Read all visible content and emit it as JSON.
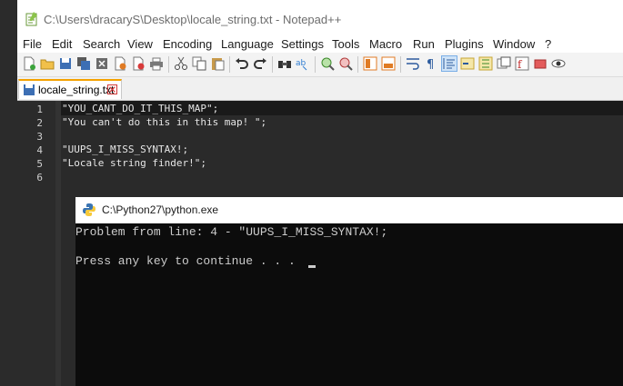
{
  "notepad": {
    "title": "C:\\Users\\dracaryS\\Desktop\\locale_string.txt - Notepad++",
    "menu": [
      "File",
      "Edit",
      "Search",
      "View",
      "Encoding",
      "Language",
      "Settings",
      "Tools",
      "Macro",
      "Run",
      "Plugins",
      "Window",
      "?"
    ],
    "tab_label": "locale_string.txt",
    "line_numbers": [
      "1",
      "2",
      "3",
      "4",
      "5",
      "6"
    ],
    "lines": [
      "\"YOU_CANT_DO_IT_THIS_MAP\";",
      "\"You can't do this in this map! \";",
      "",
      "\"UUPS_I_MISS_SYNTAX!;",
      "\"Locale string finder!\";",
      ""
    ],
    "toolbar_icons": [
      "new-file-icon",
      "open-file-icon",
      "save-icon",
      "save-all-icon",
      "close-icon",
      "close-all-icon",
      "print-icon",
      "cut-icon",
      "copy-icon",
      "paste-icon",
      "undo-icon",
      "redo-icon",
      "find-icon",
      "replace-icon",
      "zoom-in-icon",
      "zoom-out-icon",
      "sync-vertical-icon",
      "sync-horizontal-icon",
      "word-wrap-icon",
      "show-all-chars-icon",
      "indent-guide-icon",
      "doc-map-icon",
      "function-list-icon",
      "folder-workspace-icon",
      "record-macro-icon",
      "stop-macro-icon",
      "play-macro-icon"
    ]
  },
  "console": {
    "title": "C:\\Python27\\python.exe",
    "lines": [
      "Problem from line: 4 - \"UUPS_I_MISS_SYNTAX!;",
      "",
      "Press any key to continue . . . "
    ]
  },
  "colors": {
    "tab_accent": "#f4a100",
    "editor_bg": "#2a2a2a",
    "console_bg": "#0c0c0c"
  }
}
